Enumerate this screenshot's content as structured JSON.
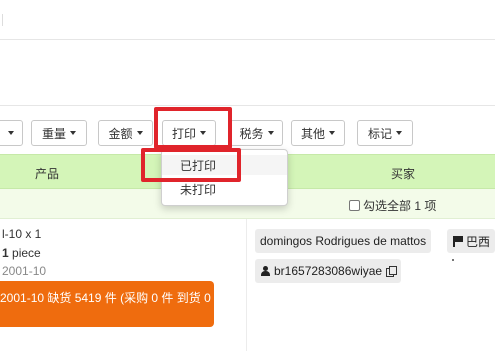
{
  "toolbar": {
    "buttons": [
      {
        "label": ""
      },
      {
        "label": "重量"
      },
      {
        "label": "金额"
      },
      {
        "label": "打印"
      },
      {
        "label": "税务"
      },
      {
        "label": "其他"
      },
      {
        "label": "标记"
      }
    ]
  },
  "print_menu": {
    "items": [
      {
        "label": "已打印",
        "selected": true
      },
      {
        "label": "未打印",
        "selected": false
      }
    ]
  },
  "table": {
    "columns": {
      "product": "产品",
      "buyer": "买家"
    },
    "select_all_label": "勾选全部 1 项"
  },
  "order": {
    "product": {
      "line1": "l-10 x 1",
      "quantity": "1",
      "unit": "piece",
      "date": "2001-10",
      "stock_alert": "2001-10 缺货 5419 件 (采购 0 件 到货 0"
    },
    "buyer": {
      "name": "domingos Rodrigues de mattos",
      "country": "巴西",
      "user_id": "br1657283086wiyae"
    }
  },
  "colors": {
    "header_green": "#d4f5b8",
    "alert_orange": "#ef6c0e",
    "highlight_red": "#e0242b"
  }
}
